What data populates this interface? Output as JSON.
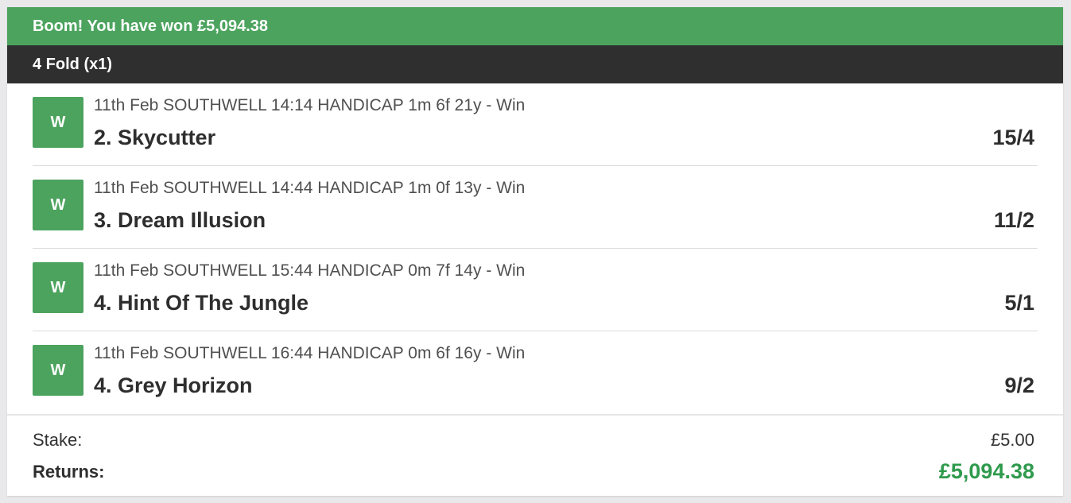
{
  "banner": {
    "text": "Boom! You have won £5,094.38"
  },
  "bet": {
    "type_label": "4 Fold (x1)"
  },
  "selections": [
    {
      "result": "W",
      "race": "11th Feb SOUTHWELL 14:14 HANDICAP 1m 6f 21y - Win",
      "runner": "2. Skycutter",
      "odds": "15/4"
    },
    {
      "result": "W",
      "race": "11th Feb SOUTHWELL 14:44 HANDICAP 1m 0f 13y - Win",
      "runner": "3. Dream Illusion",
      "odds": "11/2"
    },
    {
      "result": "W",
      "race": "11th Feb SOUTHWELL 15:44 HANDICAP 0m 7f 14y - Win",
      "runner": "4. Hint Of The Jungle",
      "odds": "5/1"
    },
    {
      "result": "W",
      "race": "11th Feb SOUTHWELL 16:44 HANDICAP 0m 6f 16y - Win",
      "runner": "4. Grey Horizon",
      "odds": "9/2"
    }
  ],
  "summary": {
    "stake_label": "Stake:",
    "stake_value": "£5.00",
    "returns_label": "Returns:",
    "returns_value": "£5,094.38"
  },
  "colors": {
    "win_green": "#4ca35e",
    "returns_green": "#2f9a4d",
    "header_dark": "#2f2f2f"
  }
}
